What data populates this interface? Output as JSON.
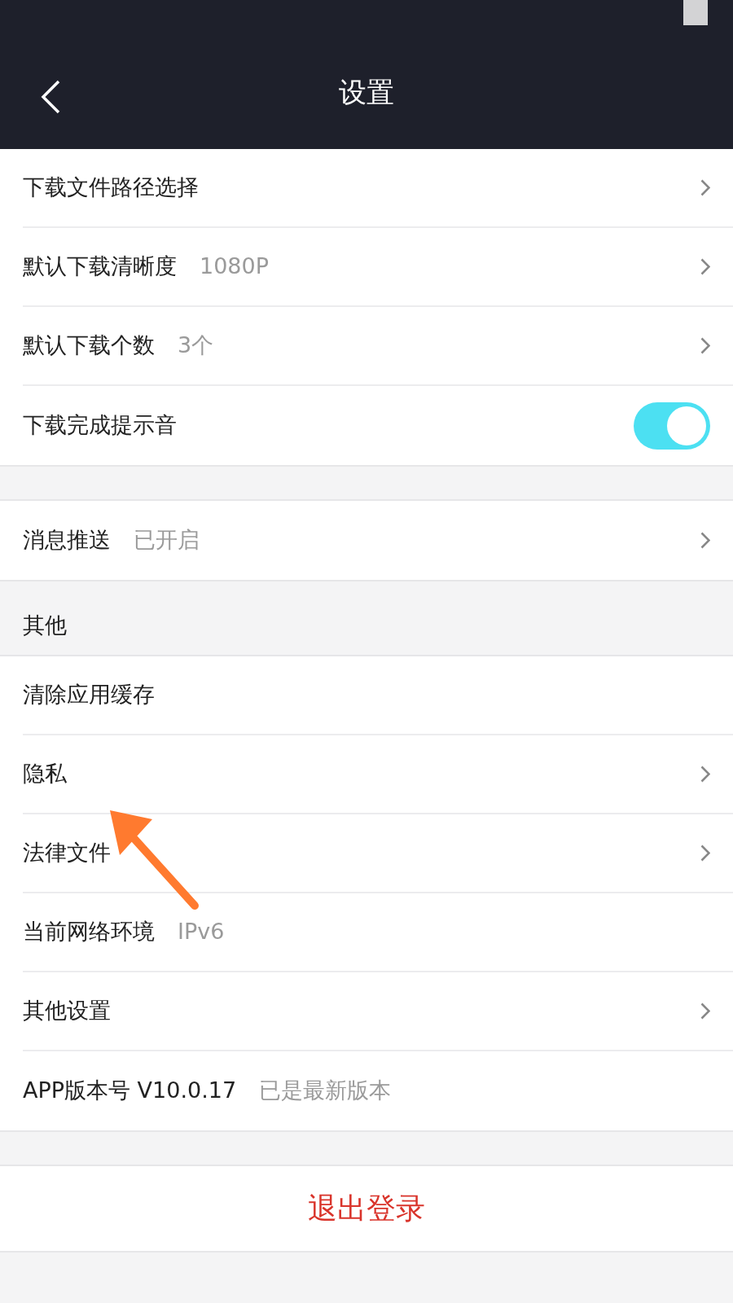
{
  "header": {
    "title": "设置"
  },
  "groups": [
    {
      "rows": [
        {
          "kind": "link",
          "label": "下载文件路径选择"
        },
        {
          "kind": "link",
          "label": "默认下载清晰度",
          "value": "1080P"
        },
        {
          "kind": "link",
          "label": "默认下载个数",
          "value": "3个"
        },
        {
          "kind": "toggle",
          "label": "下载完成提示音",
          "on": true
        }
      ]
    },
    {
      "rows": [
        {
          "kind": "link",
          "label": "消息推送",
          "value": "已开启"
        }
      ]
    },
    {
      "title": "其他",
      "rows": [
        {
          "kind": "info",
          "label": "清除应用缓存"
        },
        {
          "kind": "link",
          "label": "隐私"
        },
        {
          "kind": "link",
          "label": "法律文件"
        },
        {
          "kind": "info",
          "label": "当前网络环境",
          "value": "IPv6"
        },
        {
          "kind": "link",
          "label": "其他设置"
        },
        {
          "kind": "info",
          "label": "APP版本号 V10.0.17",
          "value": "已是最新版本"
        }
      ]
    }
  ],
  "logout": {
    "label": "退出登录"
  }
}
